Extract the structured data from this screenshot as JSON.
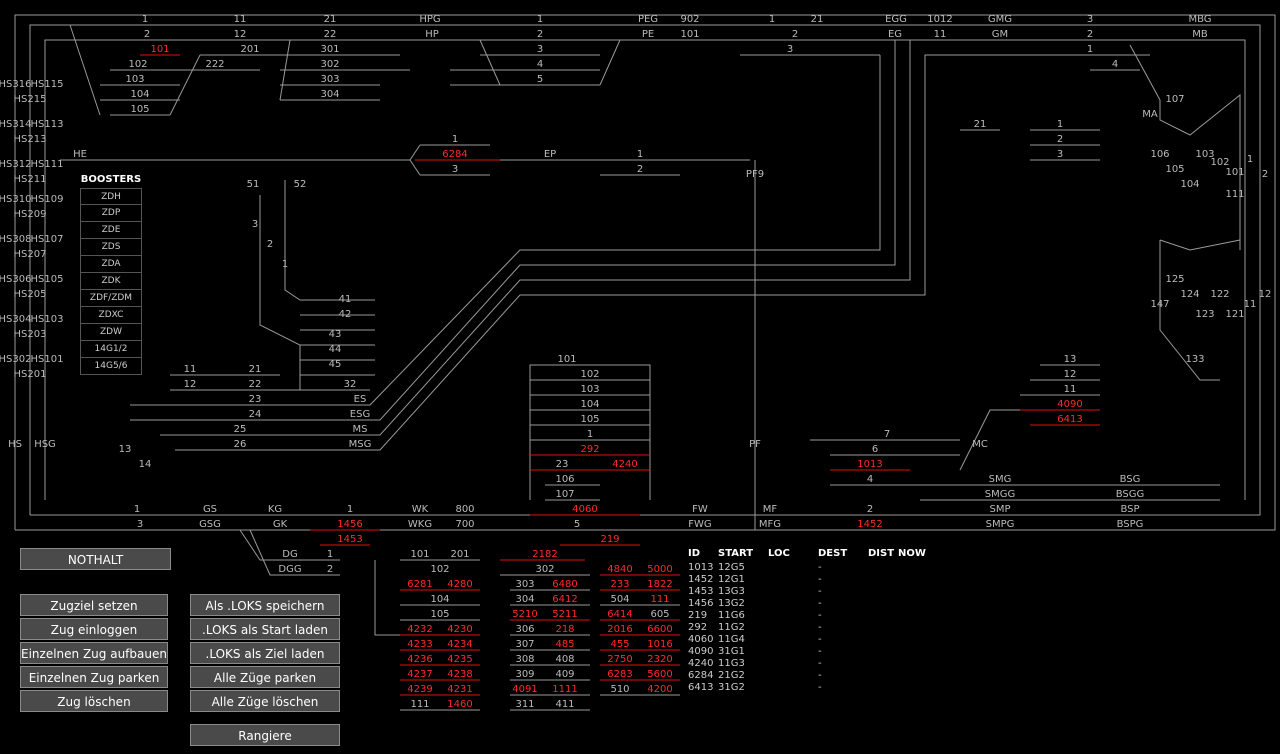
{
  "colors": {
    "background": "#000000",
    "track": "#9a9a9a",
    "occupied": "#ff2a2a",
    "button": "#4a4a4a"
  },
  "board_labels": {
    "top": [
      [
        "1",
        145,
        22
      ],
      [
        "11",
        240,
        22
      ],
      [
        "21",
        330,
        22
      ],
      [
        "HPG",
        430,
        22
      ],
      [
        "1",
        540,
        22
      ],
      [
        "PEG",
        648,
        22
      ],
      [
        "902",
        690,
        22
      ],
      [
        "1",
        772,
        22
      ],
      [
        "21",
        817,
        22
      ],
      [
        "EGG",
        896,
        22
      ],
      [
        "1012",
        940,
        22
      ],
      [
        "GMG",
        1000,
        22
      ],
      [
        "3",
        1090,
        22
      ],
      [
        "MBG",
        1200,
        22
      ],
      [
        "2",
        147,
        37
      ],
      [
        "12",
        240,
        37
      ],
      [
        "22",
        330,
        37
      ],
      [
        "HP",
        432,
        37
      ],
      [
        "2",
        540,
        37
      ],
      [
        "PE",
        648,
        37
      ],
      [
        "101",
        690,
        37
      ],
      [
        "2",
        795,
        37
      ],
      [
        "EG",
        895,
        37
      ],
      [
        "11",
        940,
        37
      ],
      [
        "GM",
        1000,
        37
      ],
      [
        "2",
        1090,
        37
      ],
      [
        "MB",
        1200,
        37
      ]
    ],
    "grey": [
      [
        "201",
        250,
        52
      ],
      [
        "301",
        330,
        52
      ],
      [
        "3",
        540,
        52
      ],
      [
        "3",
        790,
        52
      ],
      [
        "1",
        1090,
        52
      ],
      [
        "102",
        138,
        67
      ],
      [
        "222",
        215,
        67
      ],
      [
        "302",
        330,
        67
      ],
      [
        "4",
        540,
        67
      ],
      [
        "4",
        1115,
        67
      ],
      [
        "103",
        135,
        82
      ],
      [
        "303",
        330,
        82
      ],
      [
        "5",
        540,
        82
      ],
      [
        "104",
        140,
        97
      ],
      [
        "304",
        330,
        97
      ],
      [
        "105",
        140,
        112
      ],
      [
        "107",
        1175,
        102
      ],
      [
        "MA",
        1150,
        117
      ],
      [
        "21",
        980,
        127
      ],
      [
        "1",
        1060,
        127
      ],
      [
        "2",
        1060,
        142
      ],
      [
        "3",
        1060,
        157
      ],
      [
        "1",
        455,
        142
      ],
      [
        "HE",
        80,
        157
      ],
      [
        "EP",
        550,
        157
      ],
      [
        "1",
        640,
        157
      ],
      [
        "3",
        455,
        172
      ],
      [
        "2",
        640,
        172
      ],
      [
        "PF9",
        755,
        177
      ],
      [
        "106",
        1160,
        157
      ],
      [
        "103",
        1205,
        157
      ],
      [
        "102",
        1220,
        165
      ],
      [
        "1",
        1250,
        162
      ],
      [
        "2",
        1265,
        177
      ],
      [
        "105",
        1175,
        172
      ],
      [
        "101",
        1235,
        175
      ],
      [
        "104",
        1190,
        187
      ],
      [
        "111",
        1235,
        197
      ],
      [
        "51",
        253,
        187
      ],
      [
        "52",
        300,
        187
      ],
      [
        "3",
        255,
        227
      ],
      [
        "2",
        270,
        247
      ],
      [
        "1",
        285,
        267
      ],
      [
        "41",
        345,
        302
      ],
      [
        "42",
        345,
        317
      ],
      [
        "43",
        335,
        337
      ],
      [
        "44",
        335,
        352
      ],
      [
        "45",
        335,
        367
      ],
      [
        "125",
        1175,
        282
      ],
      [
        "124",
        1190,
        297
      ],
      [
        "122",
        1220,
        297
      ],
      [
        "11",
        1250,
        307
      ],
      [
        "12",
        1265,
        297
      ],
      [
        "147",
        1160,
        307
      ],
      [
        "123",
        1205,
        317
      ],
      [
        "121",
        1235,
        317
      ],
      [
        "133",
        1195,
        362
      ],
      [
        "13",
        1070,
        362
      ],
      [
        "12",
        1070,
        377
      ],
      [
        "11",
        1070,
        392
      ],
      [
        "101",
        567,
        362
      ],
      [
        "102",
        590,
        377
      ],
      [
        "103",
        590,
        392
      ],
      [
        "104",
        590,
        407
      ],
      [
        "105",
        590,
        422
      ],
      [
        "1",
        590,
        437
      ],
      [
        "11",
        190,
        372
      ],
      [
        "21",
        255,
        372
      ],
      [
        "12",
        190,
        387
      ],
      [
        "22",
        255,
        387
      ],
      [
        "32",
        350,
        387
      ],
      [
        "23",
        255,
        402
      ],
      [
        "ES",
        360,
        402
      ],
      [
        "24",
        255,
        417
      ],
      [
        "ESG",
        360,
        417
      ],
      [
        "25",
        240,
        432
      ],
      [
        "MS",
        360,
        432
      ],
      [
        "26",
        240,
        447
      ],
      [
        "MSG",
        360,
        447
      ],
      [
        "HS",
        15,
        447
      ],
      [
        "HSG",
        45,
        447
      ],
      [
        "13",
        125,
        452
      ],
      [
        "14",
        145,
        467
      ],
      [
        "PF",
        755,
        447
      ],
      [
        "7",
        887,
        437
      ],
      [
        "6",
        875,
        452
      ],
      [
        "MC",
        980,
        447
      ],
      [
        "4",
        870,
        482
      ],
      [
        "23",
        562,
        467
      ],
      [
        "106",
        565,
        482
      ],
      [
        "107",
        565,
        497
      ],
      [
        "SMG",
        1000,
        482
      ],
      [
        "BSG",
        1130,
        482
      ],
      [
        "SMGG",
        1000,
        497
      ],
      [
        "BSGG",
        1130,
        497
      ],
      [
        "1",
        137,
        512
      ],
      [
        "GS",
        210,
        512
      ],
      [
        "KG",
        275,
        512
      ],
      [
        "1",
        350,
        512
      ],
      [
        "WK",
        420,
        512
      ],
      [
        "800",
        465,
        512
      ],
      [
        "FW",
        700,
        512
      ],
      [
        "MF",
        770,
        512
      ],
      [
        "2",
        870,
        512
      ],
      [
        "SMP",
        1000,
        512
      ],
      [
        "BSP",
        1130,
        512
      ],
      [
        "3",
        140,
        527
      ],
      [
        "GSG",
        210,
        527
      ],
      [
        "GK",
        280,
        527
      ],
      [
        "WKG",
        420,
        527
      ],
      [
        "700",
        465,
        527
      ],
      [
        "5",
        577,
        527
      ],
      [
        "FWG",
        700,
        527
      ],
      [
        "MFG",
        770,
        527
      ],
      [
        "SMPG",
        1000,
        527
      ],
      [
        "BSPG",
        1130,
        527
      ],
      [
        "DG",
        290,
        557
      ],
      [
        "1",
        330,
        557
      ],
      [
        "101",
        420,
        557
      ],
      [
        "201",
        460,
        557
      ],
      [
        "DGG",
        290,
        572
      ],
      [
        "2",
        330,
        572
      ],
      [
        "102",
        440,
        572
      ],
      [
        "302",
        545,
        572
      ],
      [
        "303",
        525,
        587
      ],
      [
        "504",
        620,
        602
      ],
      [
        "104",
        440,
        602
      ],
      [
        "304",
        525,
        602
      ],
      [
        "105",
        440,
        617
      ],
      [
        "605",
        660,
        617
      ],
      [
        "306",
        525,
        632
      ],
      [
        "307",
        525,
        647
      ],
      [
        "308",
        525,
        662
      ],
      [
        "408",
        565,
        662
      ],
      [
        "309",
        525,
        677
      ],
      [
        "409",
        565,
        677
      ],
      [
        "510",
        620,
        692
      ],
      [
        "111",
        420,
        707
      ],
      [
        "311",
        525,
        707
      ],
      [
        "411",
        565,
        707
      ],
      [
        "HS316",
        15,
        87
      ],
      [
        "HS115",
        47,
        87
      ],
      [
        "HS215",
        30,
        102
      ],
      [
        "HS314",
        15,
        127
      ],
      [
        "HS113",
        47,
        127
      ],
      [
        "HS213",
        30,
        142
      ],
      [
        "HS312",
        15,
        167
      ],
      [
        "HS111",
        47,
        167
      ],
      [
        "HS211",
        30,
        182
      ],
      [
        "HS310",
        15,
        202
      ],
      [
        "HS109",
        47,
        202
      ],
      [
        "HS209",
        30,
        217
      ],
      [
        "HS308",
        15,
        242
      ],
      [
        "HS107",
        47,
        242
      ],
      [
        "HS207",
        30,
        257
      ],
      [
        "HS306",
        15,
        282
      ],
      [
        "HS105",
        47,
        282
      ],
      [
        "HS205",
        30,
        297
      ],
      [
        "HS304",
        15,
        322
      ],
      [
        "HS103",
        47,
        322
      ],
      [
        "HS203",
        30,
        337
      ],
      [
        "HS302",
        15,
        362
      ],
      [
        "HS101",
        47,
        362
      ],
      [
        "HS201",
        30,
        377
      ]
    ],
    "red": [
      [
        "101",
        160,
        52
      ],
      [
        "6284",
        455,
        157
      ],
      [
        "292",
        590,
        452
      ],
      [
        "4240",
        625,
        467
      ],
      [
        "4090",
        1070,
        407
      ],
      [
        "6413",
        1070,
        422
      ],
      [
        "1013",
        870,
        467
      ],
      [
        "4060",
        585,
        512
      ],
      [
        "1456",
        350,
        527
      ],
      [
        "1453",
        350,
        542
      ],
      [
        "1452",
        870,
        527
      ],
      [
        "219",
        610,
        542
      ],
      [
        "2182",
        545,
        557
      ],
      [
        "6281",
        420,
        587
      ],
      [
        "4280",
        460,
        587
      ],
      [
        "6480",
        565,
        587
      ],
      [
        "4840",
        620,
        572
      ],
      [
        "5000",
        660,
        572
      ],
      [
        "233",
        620,
        587
      ],
      [
        "1822",
        660,
        587
      ],
      [
        "6412",
        565,
        602
      ],
      [
        "111",
        660,
        602
      ],
      [
        "5210",
        525,
        617
      ],
      [
        "5211",
        565,
        617
      ],
      [
        "6414",
        620,
        617
      ],
      [
        "4232",
        420,
        632
      ],
      [
        "4230",
        460,
        632
      ],
      [
        "218",
        565,
        632
      ],
      [
        "2016",
        620,
        632
      ],
      [
        "6600",
        660,
        632
      ],
      [
        "4233",
        420,
        647
      ],
      [
        "4234",
        460,
        647
      ],
      [
        "485",
        565,
        647
      ],
      [
        "455",
        620,
        647
      ],
      [
        "1016",
        660,
        647
      ],
      [
        "4236",
        420,
        662
      ],
      [
        "4235",
        460,
        662
      ],
      [
        "2750",
        620,
        662
      ],
      [
        "2320",
        660,
        662
      ],
      [
        "4237",
        420,
        677
      ],
      [
        "4238",
        460,
        677
      ],
      [
        "6283",
        620,
        677
      ],
      [
        "5600",
        660,
        677
      ],
      [
        "4239",
        420,
        692
      ],
      [
        "4231",
        460,
        692
      ],
      [
        "4091",
        525,
        692
      ],
      [
        "1111",
        565,
        692
      ],
      [
        "4200",
        660,
        692
      ],
      [
        "1460",
        460,
        707
      ]
    ]
  },
  "boosters": {
    "title": "BOOSTERS",
    "items": [
      "ZDH",
      "ZDP",
      "ZDE",
      "ZDS",
      "ZDA",
      "ZDK",
      "ZDF/ZDM",
      "ZDXC",
      "ZDW",
      "14G1/2",
      "14G5/6"
    ]
  },
  "train_table": {
    "headers": {
      "id": "ID",
      "start": "START",
      "loc": "LOC",
      "dest": "DEST",
      "dist": "DIST",
      "now": "NOW"
    },
    "rows": [
      [
        "1013",
        "12G5",
        "-"
      ],
      [
        "1452",
        "12G1",
        "-"
      ],
      [
        "1453",
        "13G3",
        "-"
      ],
      [
        "1456",
        "13G2",
        "-"
      ],
      [
        "219",
        "11G6",
        "-"
      ],
      [
        "292",
        "11G2",
        "-"
      ],
      [
        "4060",
        "11G4",
        "-"
      ],
      [
        "4090",
        "31G1",
        "-"
      ],
      [
        "4240",
        "11G3",
        "-"
      ],
      [
        "6284",
        "21G2",
        "-"
      ],
      [
        "6413",
        "31G2",
        "-"
      ]
    ]
  },
  "buttons": {
    "nothalt": "NOTHALT",
    "zugziel_setzen": "Zugziel setzen",
    "zug_einloggen": "Zug einloggen",
    "einzelnen_aufbauen": "Einzelnen Zug aufbauen",
    "einzelnen_parken": "Einzelnen Zug parken",
    "zug_loeschen": "Zug löschen",
    "loks_speichern": "Als .LOKS speichern",
    "loks_start": ".LOKS als Start laden",
    "loks_ziel": ".LOKS als Ziel laden",
    "alle_parken": "Alle Züge parken",
    "alle_loeschen": "Alle Züge löschen",
    "rangiere": "Rangiere"
  }
}
